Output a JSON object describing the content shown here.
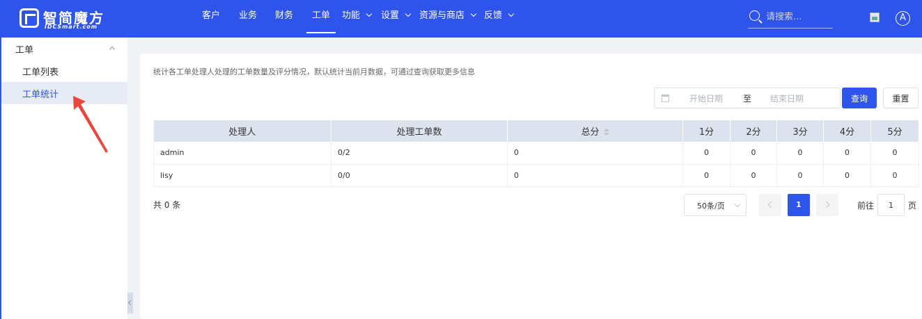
{
  "brand": {
    "name": "智简魔方",
    "sub": "IDCSmart.com"
  },
  "nav": [
    {
      "label": "客户",
      "dropdown": false
    },
    {
      "label": "业务",
      "dropdown": false
    },
    {
      "label": "财务",
      "dropdown": false
    },
    {
      "label": "工单",
      "dropdown": false,
      "active": true
    },
    {
      "label": "功能",
      "dropdown": true
    },
    {
      "label": "设置",
      "dropdown": true
    },
    {
      "label": "资源与商店",
      "dropdown": true
    },
    {
      "label": "反馈",
      "dropdown": true
    }
  ],
  "search": {
    "placeholder": "请搜索..."
  },
  "user": {
    "avatar_letter": "A"
  },
  "sidebar": {
    "group_label": "工单",
    "items": [
      {
        "label": "工单列表",
        "active": false
      },
      {
        "label": "工单统计",
        "active": true
      }
    ]
  },
  "main": {
    "description": "统计各工单处理人处理的工单数量及评分情况，默认统计当前月数据，可通过查询获取更多信息",
    "filter": {
      "start_placeholder": "开始日期",
      "separator": "至",
      "end_placeholder": "结束日期",
      "query_label": "查询",
      "reset_label": "重置"
    },
    "table": {
      "headers": [
        "处理人",
        "处理工单数",
        "总分",
        "1分",
        "2分",
        "3分",
        "4分",
        "5分"
      ],
      "rows": [
        [
          "admin",
          "0/2",
          "0",
          "0",
          "0",
          "0",
          "0",
          "0"
        ],
        [
          "lisy",
          "0/0",
          "0",
          "0",
          "0",
          "0",
          "0",
          "0"
        ]
      ]
    },
    "pagination": {
      "total_text": "共 0 条",
      "page_size": "50条/页",
      "current_page": "1",
      "goto_label": "前往",
      "goto_value": "1",
      "goto_suffix": "页"
    }
  },
  "colors": {
    "primary": "#2f54eb",
    "header_bg": "#dde3ee",
    "arrow": "#e8483c"
  }
}
